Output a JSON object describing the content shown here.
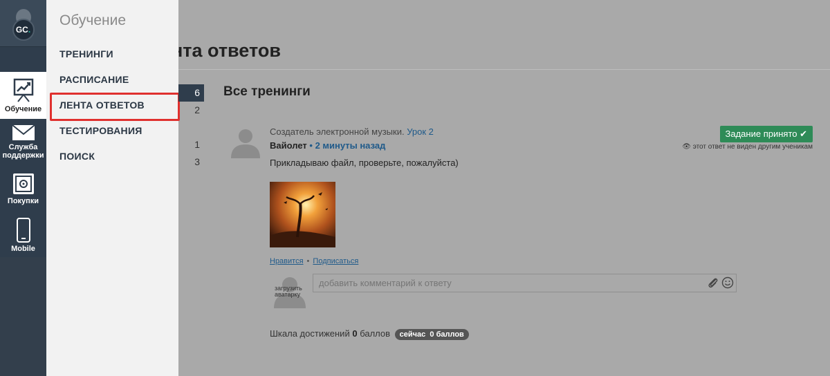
{
  "rail": {
    "logo_text": "GC",
    "logo_dot": ".",
    "items": [
      {
        "label": "Обучение",
        "icon": "chart-board-icon"
      },
      {
        "label": "Служба поддержки",
        "icon": "envelope-icon"
      },
      {
        "label": "Покупки",
        "icon": "safe-icon"
      },
      {
        "label": "Mobile",
        "icon": "phone-icon"
      }
    ]
  },
  "menu": {
    "title": "Обучение",
    "items": [
      "ТРЕНИНГИ",
      "РАСПИСАНИЕ",
      "ЛЕНТА ОТВЕТОВ",
      "ТЕСТИРОВАНИЯ",
      "ПОИСК"
    ]
  },
  "main": {
    "heading": "Лента ответов",
    "section_title": "Все тренинги",
    "counts": [
      "6",
      "2",
      "",
      "1",
      "3"
    ]
  },
  "answer": {
    "training": "Создатель электронной музыки.",
    "lesson": "Урок 2",
    "author": "Вайолет",
    "separator": "•",
    "time": "2 минуты назад",
    "text": "Прикладываю файл, проверьте, пожалуйста)",
    "status": "Задание принято ✔",
    "visibility_note": "этот ответ не виден другим ученикам",
    "like": "Нравится",
    "subscribe": "Подписаться",
    "links_sep": "•"
  },
  "comment": {
    "avatar_text": "загрузить аватарку",
    "placeholder": "добавить комментарий к ответу"
  },
  "scale": {
    "label": "Шкала достижений",
    "points": "0",
    "points_unit": "баллов",
    "now_label": "сейчас",
    "now_points": "0 баллов"
  },
  "colors": {
    "rail_bg": "#2f3d4c",
    "overlay_bg": "#a9a9a9",
    "menu_bg": "#f2f2f2",
    "highlight": "#e0302e",
    "accent_green": "#2e8b57",
    "link": "#1f5a8a"
  }
}
